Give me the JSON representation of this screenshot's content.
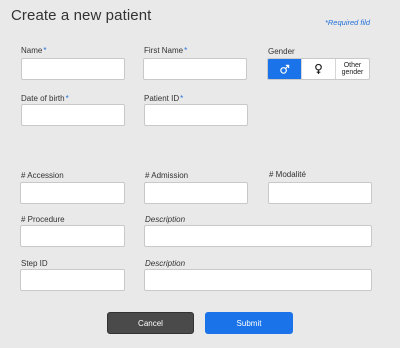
{
  "title": "Create a new patient",
  "required_note": {
    "star": "*",
    "text": "Required fild"
  },
  "fields": {
    "name": {
      "label": "Name",
      "value": ""
    },
    "first_name": {
      "label": "First Name",
      "value": ""
    },
    "gender": {
      "label": "Gender",
      "options": [
        {
          "icon": "male-icon",
          "label": "",
          "active": true
        },
        {
          "icon": "female-icon",
          "label": "",
          "active": false
        },
        {
          "icon": "",
          "label": "Other gender",
          "active": false
        }
      ]
    },
    "dob": {
      "label": "Date of birth",
      "value": ""
    },
    "patient_id": {
      "label": "Patient ID",
      "value": ""
    },
    "accession": {
      "label": "# Accession",
      "value": ""
    },
    "admission": {
      "label": "# Admission",
      "value": ""
    },
    "modalite": {
      "label": "# Modalité",
      "value": ""
    },
    "procedure": {
      "label": "# Procedure",
      "value": ""
    },
    "description1": {
      "label": "Description",
      "value": ""
    },
    "step_id": {
      "label": "Step ID",
      "value": ""
    },
    "description2": {
      "label": "Description",
      "value": ""
    }
  },
  "buttons": {
    "cancel": "Cancel",
    "submit": "Submit"
  },
  "colors": {
    "accent": "#1a73e8",
    "cancel": "#4a4a4a",
    "background": "#e9e9e9"
  },
  "star": "*"
}
